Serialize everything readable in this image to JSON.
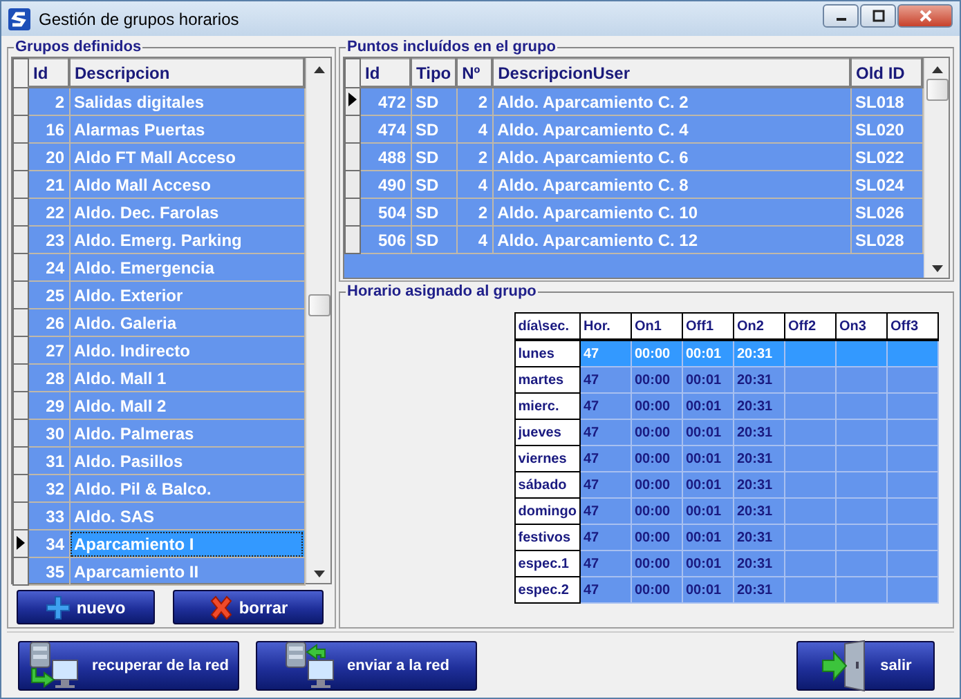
{
  "window": {
    "title": "Gestión de grupos horarios"
  },
  "groups": {
    "title": "Grupos definidos",
    "columns": [
      "Id",
      "Descripcion"
    ],
    "rows": [
      {
        "id": "2",
        "description": "Salidas digitales",
        "selected": false
      },
      {
        "id": "16",
        "description": "Alarmas Puertas",
        "selected": false
      },
      {
        "id": "20",
        "description": "Aldo FT Mall Acceso",
        "selected": false
      },
      {
        "id": "21",
        "description": "Aldo Mall Acceso",
        "selected": false
      },
      {
        "id": "22",
        "description": "Aldo. Dec. Farolas",
        "selected": false
      },
      {
        "id": "23",
        "description": "Aldo. Emerg. Parking",
        "selected": false
      },
      {
        "id": "24",
        "description": "Aldo. Emergencia",
        "selected": false
      },
      {
        "id": "25",
        "description": "Aldo. Exterior",
        "selected": false
      },
      {
        "id": "26",
        "description": "Aldo. Galeria",
        "selected": false
      },
      {
        "id": "27",
        "description": "Aldo. Indirecto",
        "selected": false
      },
      {
        "id": "28",
        "description": "Aldo. Mall 1",
        "selected": false
      },
      {
        "id": "29",
        "description": "Aldo. Mall 2",
        "selected": false
      },
      {
        "id": "30",
        "description": "Aldo. Palmeras",
        "selected": false
      },
      {
        "id": "31",
        "description": "Aldo. Pasillos",
        "selected": false
      },
      {
        "id": "32",
        "description": "Aldo. Pil & Balco.",
        "selected": false
      },
      {
        "id": "33",
        "description": "Aldo. SAS",
        "selected": false
      },
      {
        "id": "34",
        "description": "Aparcamiento I",
        "selected": true
      },
      {
        "id": "35",
        "description": "Aparcamiento II",
        "selected": false
      }
    ]
  },
  "group_buttons": [
    {
      "label": "nuevo",
      "kind": "add"
    },
    {
      "label": "borrar",
      "kind": "delete"
    }
  ],
  "points": {
    "title": "Puntos incluídos en el grupo",
    "columns": [
      "Id",
      "Tipo",
      "Nº",
      "DescripcionUser",
      "Old ID"
    ],
    "rows": [
      {
        "cells": [
          "472",
          "SD",
          "2",
          "Aldo. Aparcamiento C. 2",
          "SL018"
        ],
        "selected": true
      },
      {
        "cells": [
          "474",
          "SD",
          "4",
          "Aldo. Aparcamiento C. 4",
          "SL020"
        ],
        "selected": false
      },
      {
        "cells": [
          "488",
          "SD",
          "2",
          "Aldo. Aparcamiento C. 6",
          "SL022"
        ],
        "selected": false
      },
      {
        "cells": [
          "490",
          "SD",
          "4",
          "Aldo. Aparcamiento C. 8",
          "SL024"
        ],
        "selected": false
      },
      {
        "cells": [
          "504",
          "SD",
          "2",
          "Aldo. Aparcamiento C. 10",
          "SL026"
        ],
        "selected": false
      },
      {
        "cells": [
          "506",
          "SD",
          "4",
          "Aldo. Aparcamiento C. 12",
          "SL028"
        ],
        "selected": false
      }
    ]
  },
  "schedule": {
    "title": "Horario asignado al grupo",
    "columns": [
      "día\\sec.",
      "Hor.",
      "On1",
      "Off1",
      "On2",
      "Off2",
      "On3",
      "Off3"
    ],
    "rows": [
      {
        "cells": [
          "lunes",
          "47",
          "00:00",
          "00:01",
          "20:31"
        ],
        "selected": true
      },
      {
        "cells": [
          "martes",
          "47",
          "00:00",
          "00:01",
          "20:31"
        ],
        "selected": false
      },
      {
        "cells": [
          "mierc.",
          "47",
          "00:00",
          "00:01",
          "20:31"
        ],
        "selected": false
      },
      {
        "cells": [
          "jueves",
          "47",
          "00:00",
          "00:01",
          "20:31"
        ],
        "selected": false
      },
      {
        "cells": [
          "viernes",
          "47",
          "00:00",
          "00:01",
          "20:31"
        ],
        "selected": false
      },
      {
        "cells": [
          "sábado",
          "47",
          "00:00",
          "00:01",
          "20:31"
        ],
        "selected": false
      },
      {
        "cells": [
          "domingo",
          "47",
          "00:00",
          "00:01",
          "20:31"
        ],
        "selected": false
      },
      {
        "cells": [
          "festivos",
          "47",
          "00:00",
          "00:01",
          "20:31"
        ],
        "selected": false
      },
      {
        "cells": [
          "espec.1",
          "47",
          "00:00",
          "00:01",
          "20:31"
        ],
        "selected": false
      },
      {
        "cells": [
          "espec.2",
          "47",
          "00:00",
          "00:01",
          "20:31"
        ],
        "selected": false
      }
    ]
  },
  "footer_buttons": [
    {
      "label": "recuperar de la red",
      "kind": "download"
    },
    {
      "label": "enviar a la red",
      "kind": "upload"
    },
    {
      "label": "salir",
      "kind": "exit"
    }
  ]
}
